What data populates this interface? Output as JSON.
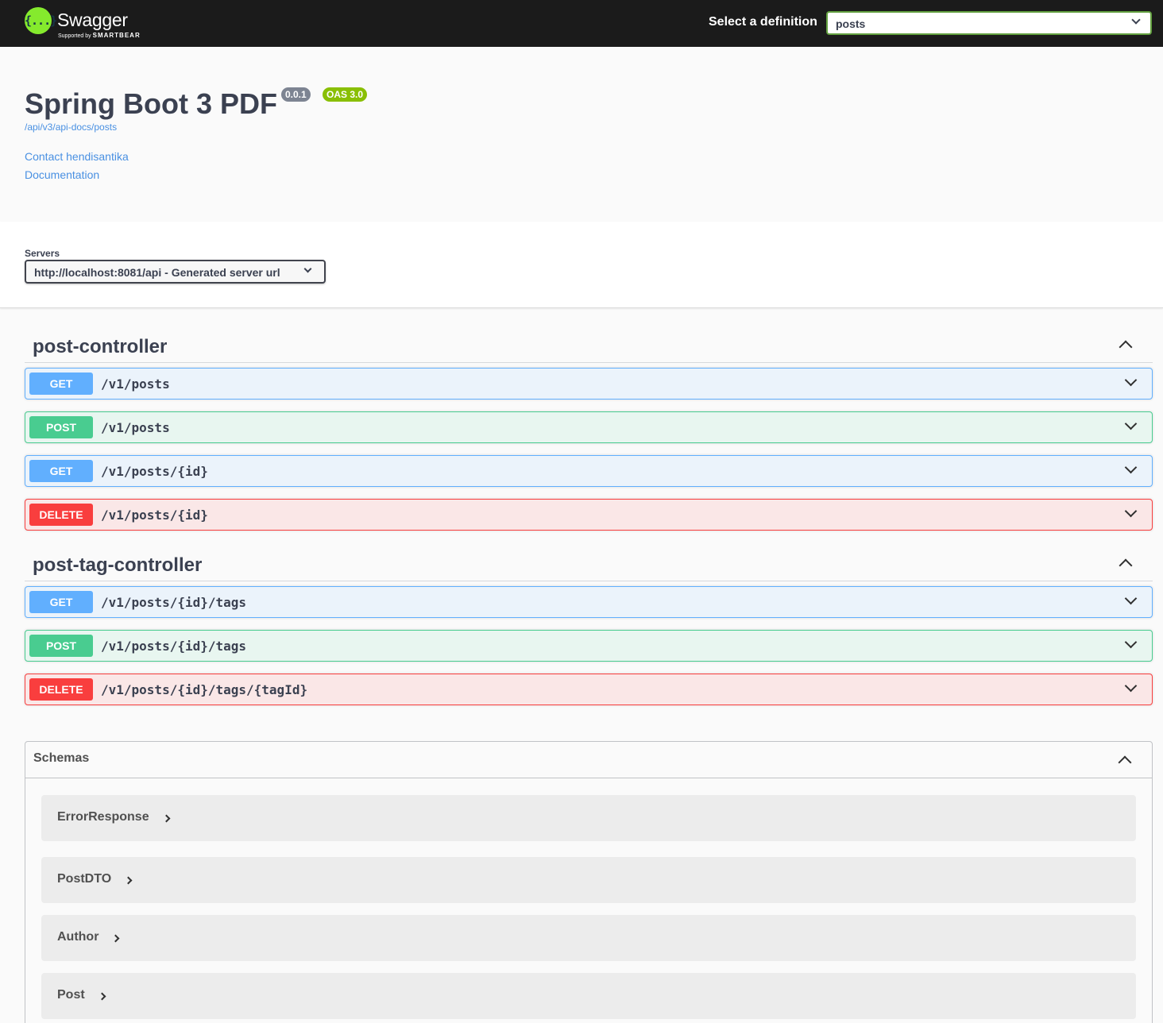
{
  "topbar": {
    "logo_glyph": "{...}",
    "brand_name": "Swagger",
    "brand_sub_prefix": "Supported by",
    "brand_sub_company": "SMARTBEAR",
    "definition_label": "Select a definition",
    "definition_value": "posts"
  },
  "info": {
    "title": "Spring Boot 3 PDF",
    "version": "0.0.1",
    "oas": "OAS 3.0",
    "spec_url": "/api/v3/api-docs/posts",
    "contact_link": "Contact hendisantika",
    "docs_link": "Documentation"
  },
  "servers": {
    "label": "Servers",
    "selected": "http://localhost:8081/api - Generated server url"
  },
  "tags": [
    {
      "name": "post-controller",
      "operations": [
        {
          "method": "GET",
          "path": "/v1/posts"
        },
        {
          "method": "POST",
          "path": "/v1/posts"
        },
        {
          "method": "GET",
          "path": "/v1/posts/{id}"
        },
        {
          "method": "DELETE",
          "path": "/v1/posts/{id}"
        }
      ]
    },
    {
      "name": "post-tag-controller",
      "operations": [
        {
          "method": "GET",
          "path": "/v1/posts/{id}/tags"
        },
        {
          "method": "POST",
          "path": "/v1/posts/{id}/tags"
        },
        {
          "method": "DELETE",
          "path": "/v1/posts/{id}/tags/{tagId}"
        }
      ]
    }
  ],
  "schemas": {
    "title": "Schemas",
    "items": [
      "ErrorResponse",
      "PostDTO",
      "Author",
      "Post"
    ]
  },
  "colors": {
    "get": "#61affe",
    "post": "#49cc90",
    "delete": "#f93e3e",
    "topbar": "#1b1b1b",
    "logo": "#85ea2d",
    "link": "#4990e2"
  },
  "icons": {
    "logo": "swagger-logo-icon",
    "collapse": "chevron-up-icon",
    "expand": "chevron-down-icon",
    "schema_expand": "chevron-right-icon"
  }
}
